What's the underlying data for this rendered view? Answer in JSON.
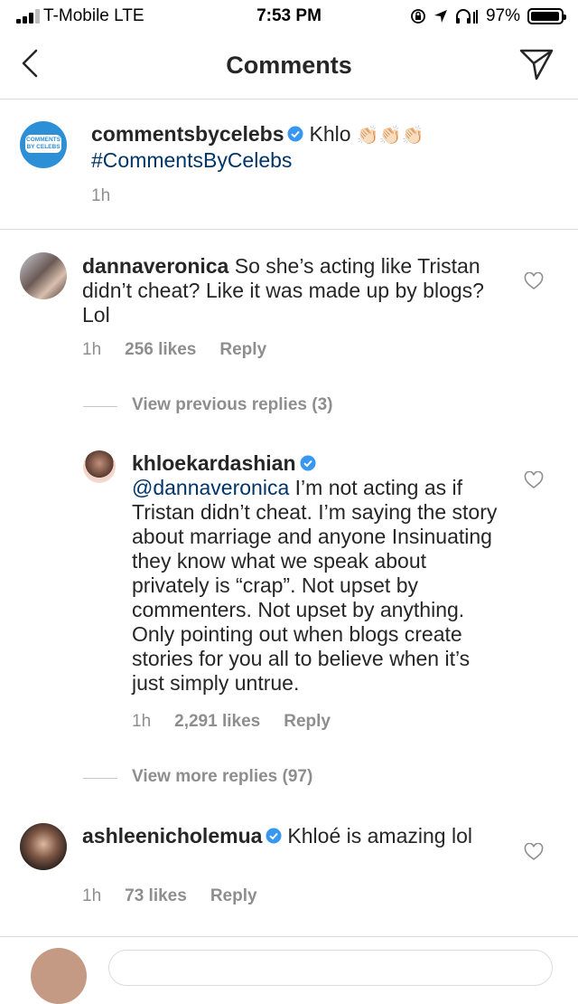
{
  "status_bar": {
    "carrier": "T-Mobile  LTE",
    "time": "7:53 PM",
    "battery": "97%",
    "battery_level": 0.97
  },
  "header": {
    "title": "Comments"
  },
  "caption": {
    "logo_text_line1": "COMMENTS",
    "logo_text_line2": "BY CELEBS",
    "username": "commentsbyceleb s",
    "text": "Khlo",
    "emoji": "👏🏻👏🏻👏🏻",
    "hashtag": "#CommentsByCelebs",
    "time": "1h"
  },
  "comments": [
    {
      "username": "dannaveronica",
      "text": "So she’s acting like Tristan didn’t cheat? Like it was made up by blogs? Lol",
      "time": "1h",
      "likes": "256 likes",
      "reply": "Reply",
      "view_replies": "View previous replies (3)"
    },
    {
      "username": "khloekardashian",
      "mention": "@dannaveronica",
      "text": "I’m not acting as if Tristan didn’t cheat. I’m saying the story about marriage and anyone Insinuating they know what we speak about privately is “crap”. Not upset by commenters. Not upset by anything. Only pointing out when blogs create stories for you all to believe when it’s just simply untrue.",
      "time": "1h",
      "likes": "2,291 likes",
      "reply": "Reply",
      "view_replies": "View more replies (97)"
    },
    {
      "username": "ashleenicholemua",
      "text": "Khloé is amazing lol",
      "time": "1h",
      "likes": "73 likes",
      "reply": "Reply"
    }
  ],
  "colors": {
    "verified": "#3897f0",
    "link": "#003569",
    "meta": "#8e8e8e",
    "logo": "#2d8fd5"
  },
  "icons": [
    "back-icon",
    "send-icon",
    "verified-icon",
    "heart-icon"
  ]
}
